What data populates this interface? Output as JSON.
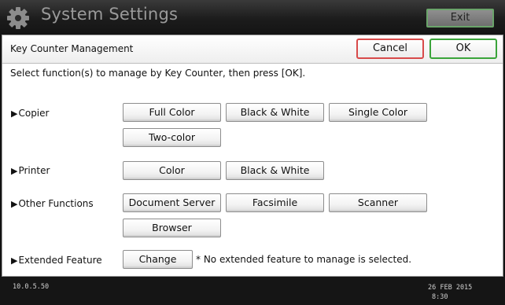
{
  "header": {
    "app_title": "System Settings",
    "exit_label": "Exit",
    "icon": "gear-icon"
  },
  "panel": {
    "title": "Key Counter Management",
    "cancel_label": "Cancel",
    "ok_label": "OK",
    "instruction": "Select function(s) to manage by Key Counter, then press [OK]."
  },
  "sections": {
    "copier": {
      "label": "Copier",
      "buttons": [
        "Full Color",
        "Black & White",
        "Single Color",
        "Two-color"
      ]
    },
    "printer": {
      "label": "Printer",
      "buttons": [
        "Color",
        "Black & White"
      ]
    },
    "other": {
      "label": "Other Functions",
      "buttons": [
        "Document Server",
        "Facsimile",
        "Scanner",
        "Browser"
      ]
    },
    "extended": {
      "label": "Extended Feature",
      "change_label": "Change",
      "note": "* No extended feature to manage is selected."
    }
  },
  "status": {
    "ip": "10.0.5.50",
    "date": "26 FEB  2015",
    "time": "8:30"
  },
  "colors": {
    "title_bar": "#1c1c1c",
    "cancel_border": "#d84a4a",
    "ok_border": "#3aa43a",
    "exit_border": "#6aa46a"
  }
}
